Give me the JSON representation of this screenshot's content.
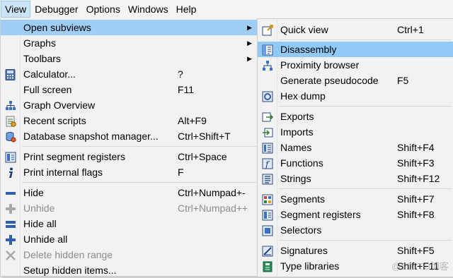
{
  "menubar": [
    {
      "label": "View",
      "active": true
    },
    {
      "label": "Debugger",
      "active": false
    },
    {
      "label": "Options",
      "active": false
    },
    {
      "label": "Windows",
      "active": false
    },
    {
      "label": "Help",
      "active": false
    }
  ],
  "view_menu": {
    "items": [
      {
        "label": "Open subviews",
        "shortcut": "",
        "submenu": true,
        "highlighted": true,
        "icon": "none"
      },
      {
        "label": "Graphs",
        "shortcut": "",
        "submenu": true,
        "icon": "none"
      },
      {
        "label": "Toolbars",
        "shortcut": "",
        "submenu": true,
        "icon": "none"
      },
      {
        "label": "Calculator...",
        "shortcut": "?",
        "icon": "calculator-icon"
      },
      {
        "label": "Full screen",
        "shortcut": "F11",
        "icon": "none"
      },
      {
        "label": "Graph Overview",
        "shortcut": "",
        "icon": "graph-overview-icon"
      },
      {
        "label": "Recent scripts",
        "shortcut": "Alt+F9",
        "icon": "recent-scripts-icon"
      },
      {
        "label": "Database snapshot manager...",
        "shortcut": "Ctrl+Shift+T",
        "icon": "database-snapshot-icon"
      },
      {
        "label": "Print segment registers",
        "shortcut": "Ctrl+Space",
        "icon": "segment-registers-icon"
      },
      {
        "label": "Print internal flags",
        "shortcut": "F",
        "icon": "info-icon"
      },
      {
        "label": "Hide",
        "shortcut": "Ctrl+Numpad+-",
        "icon": "minus-icon"
      },
      {
        "label": "Unhide",
        "shortcut": "Ctrl+Numpad++",
        "disabled": true,
        "icon": "plus-icon"
      },
      {
        "label": "Hide all",
        "shortcut": "",
        "icon": "minus-all-icon"
      },
      {
        "label": "Unhide all",
        "shortcut": "",
        "icon": "plus-all-icon"
      },
      {
        "label": "Delete hidden range",
        "shortcut": "",
        "disabled": true,
        "icon": "delete-icon"
      },
      {
        "label": "Setup hidden items...",
        "shortcut": "",
        "icon": "none"
      }
    ]
  },
  "sub_menu": {
    "items": [
      {
        "label": "Quick view",
        "shortcut": "Ctrl+1",
        "icon": "quick-view-icon"
      },
      {
        "label": "Disassembly",
        "shortcut": "",
        "highlighted": true,
        "icon": "disassembly-icon"
      },
      {
        "label": "Proximity browser",
        "shortcut": "",
        "icon": "proximity-icon"
      },
      {
        "label": "Generate pseudocode",
        "shortcut": "F5",
        "icon": "none"
      },
      {
        "label": "Hex dump",
        "shortcut": "",
        "icon": "hex-dump-icon"
      },
      {
        "label": "Exports",
        "shortcut": "",
        "icon": "exports-icon"
      },
      {
        "label": "Imports",
        "shortcut": "",
        "icon": "imports-icon"
      },
      {
        "label": "Names",
        "shortcut": "Shift+F4",
        "icon": "names-icon"
      },
      {
        "label": "Functions",
        "shortcut": "Shift+F3",
        "icon": "functions-icon"
      },
      {
        "label": "Strings",
        "shortcut": "Shift+F12",
        "icon": "strings-icon"
      },
      {
        "label": "Segments",
        "shortcut": "Shift+F7",
        "icon": "segments-icon"
      },
      {
        "label": "Segment registers",
        "shortcut": "Shift+F8",
        "icon": "segment-registers-icon"
      },
      {
        "label": "Selectors",
        "shortcut": "",
        "icon": "selectors-icon"
      },
      {
        "label": "Signatures",
        "shortcut": "Shift+F5",
        "icon": "signatures-icon"
      },
      {
        "label": "Type libraries",
        "shortcut": "Shift+F11",
        "icon": "type-libraries-icon"
      }
    ]
  },
  "watermark": "@51CTO博客",
  "colors": {
    "highlight": "#91c9f7",
    "menu_bg": "#f2f2f2",
    "disabled_text": "#8c8c8c"
  }
}
